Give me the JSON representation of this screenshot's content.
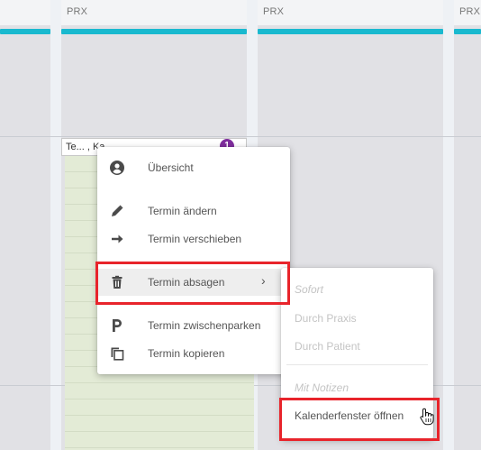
{
  "calendar": {
    "columns": [
      {
        "label": "PRX"
      },
      {
        "label": "PRX"
      },
      {
        "label": "PRX"
      }
    ],
    "accent_color": "#19b9cf"
  },
  "appointment": {
    "title": "Te... , Ka...",
    "badge": "1",
    "badge_color": "#7e2d9c",
    "background_color": "#e3ebd6"
  },
  "context_menu": {
    "items": [
      {
        "label": "Übersicht",
        "icon": "account-circle-icon"
      },
      {
        "label": "Termin ändern",
        "icon": "pencil-icon"
      },
      {
        "label": "Termin verschieben",
        "icon": "arrow-right-icon"
      },
      {
        "label": "Termin absagen",
        "icon": "trash-icon",
        "has_submenu": true,
        "chevron": "›"
      },
      {
        "label": "Termin zwischenparken",
        "icon": "parking-p-icon"
      },
      {
        "label": "Termin kopieren",
        "icon": "copy-icon"
      }
    ]
  },
  "submenu": {
    "items": [
      {
        "label": "Sofort"
      },
      {
        "label": "Durch Praxis"
      },
      {
        "label": "Durch Patient"
      },
      {
        "label": "Mit Notizen"
      },
      {
        "label": "Kalenderfenster öffnen"
      }
    ]
  },
  "highlight_color": "#e8242b"
}
